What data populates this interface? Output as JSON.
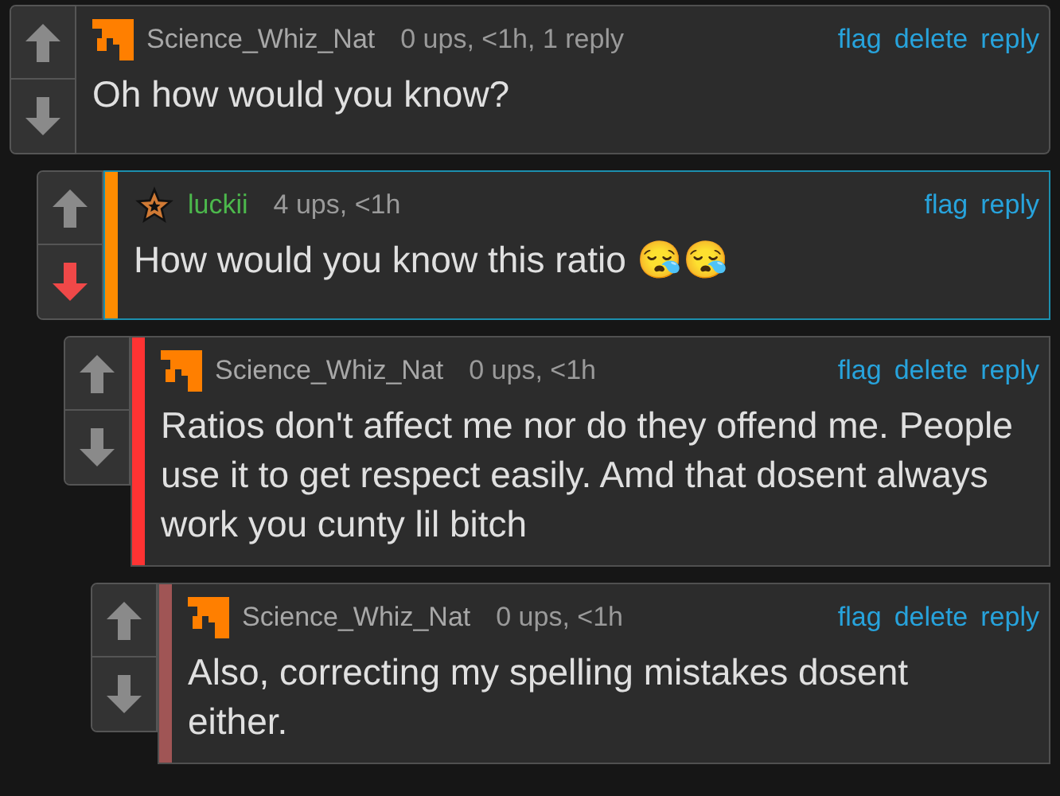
{
  "comments": [
    {
      "user": {
        "name": "Science_Whiz_Nat",
        "color": "#a8a8a8"
      },
      "avatar": {
        "kind": "logo"
      },
      "meta": "0 ups, <1h, 1 reply",
      "actions": [
        "flag",
        "delete",
        "reply"
      ],
      "text": "Oh how would you know?",
      "downvoted": false,
      "highlighted": false,
      "children": [
        {
          "user": {
            "name": "luckii",
            "color": "#4cb84c"
          },
          "avatar": {
            "kind": "star"
          },
          "meta": "4 ups, <1h",
          "actions": [
            "flag",
            "reply"
          ],
          "text": "How would you know this ratio 😪😪",
          "downvoted": true,
          "highlighted": true,
          "bar": {
            "color": "#ff8c00"
          },
          "children": [
            {
              "user": {
                "name": "Science_Whiz_Nat",
                "color": "#a8a8a8"
              },
              "avatar": {
                "kind": "logo"
              },
              "meta": "0 ups, <1h",
              "actions": [
                "flag",
                "delete",
                "reply"
              ],
              "text": "Ratios don't affect me nor do they offend me. People use it to get respect easily. Amd that dosent always work you cunty lil bitch",
              "downvoted": false,
              "highlighted": false,
              "bar": {
                "color": "#ff3333"
              },
              "children": [
                {
                  "user": {
                    "name": "Science_Whiz_Nat",
                    "color": "#a8a8a8"
                  },
                  "avatar": {
                    "kind": "logo"
                  },
                  "meta": "0 ups, <1h",
                  "actions": [
                    "flag",
                    "delete",
                    "reply"
                  ],
                  "text": "Also, correcting my spelling mistakes dosent either.",
                  "downvoted": false,
                  "highlighted": false,
                  "bar": {
                    "color": "#a05555"
                  }
                }
              ]
            }
          ]
        }
      ]
    }
  ]
}
